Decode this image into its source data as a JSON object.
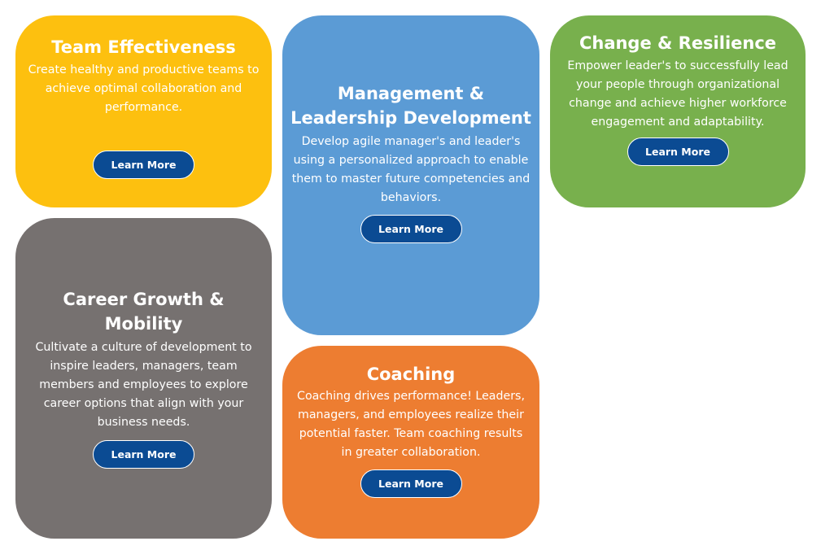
{
  "cards": [
    {
      "title": "Team Effectiveness",
      "description": "Create healthy and productive teams to achieve optimal collaboration and performance.",
      "button_label": "Learn More",
      "color": "#fdc00f"
    },
    {
      "title": "Management & Leadership Development",
      "description": "Develop agile manager's and leader's using a personalized approach to enable them to master future competencies and behaviors.",
      "button_label": "Learn More",
      "color": "#5b9bd5"
    },
    {
      "title": "Change & Resilience",
      "description": "Empower leader's to successfully lead your people through organizational change and achieve higher workforce engagement and adaptability.",
      "button_label": "Learn More",
      "color": "#78b04d"
    },
    {
      "title": "Career Growth & Mobility",
      "description": "Cultivate a culture of development to inspire leaders, managers, team members and employees to explore career options that align with your business needs.",
      "button_label": "Learn More",
      "color": "#767170"
    },
    {
      "title": "Coaching",
      "description": "Coaching drives performance! Leaders, managers, and employees realize their potential faster. Team coaching results in greater collaboration.",
      "button_label": "Learn More",
      "color": "#ed7d31"
    }
  ],
  "button_color": "#0b4b93"
}
